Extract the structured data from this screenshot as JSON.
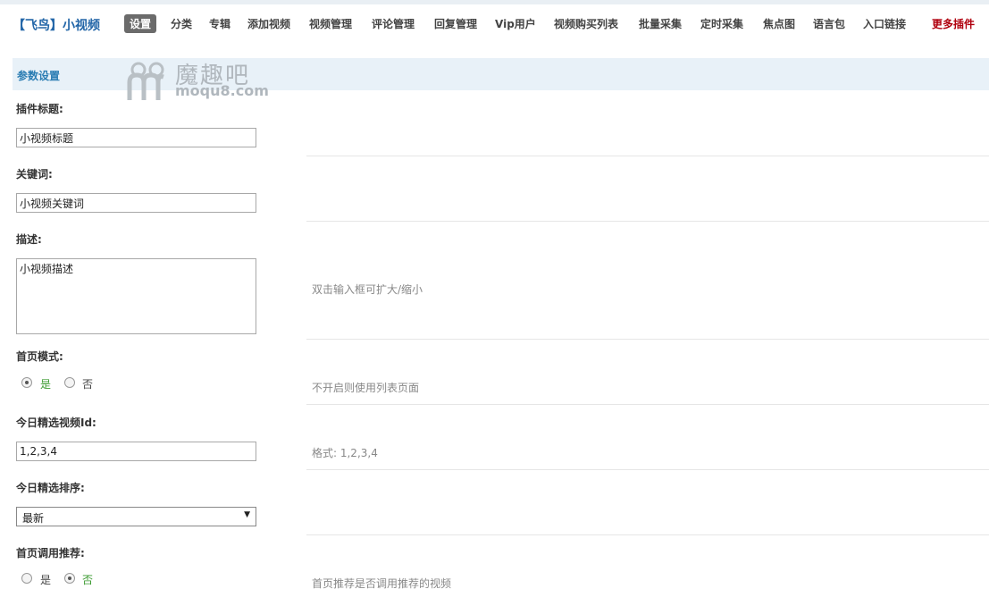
{
  "header": {
    "brand": "【飞鸟】小视频",
    "nav": [
      {
        "label": "设置",
        "active": true
      },
      {
        "label": "分类"
      },
      {
        "label": "专辑"
      },
      {
        "label": "添加视频"
      },
      {
        "label": "视频管理"
      },
      {
        "label": "评论管理"
      },
      {
        "label": "回复管理"
      },
      {
        "label": "Vip用户"
      },
      {
        "label": "视频购买列表"
      },
      {
        "label": "批量采集"
      },
      {
        "label": "定时采集"
      },
      {
        "label": "焦点图"
      },
      {
        "label": "语言包"
      },
      {
        "label": "入口链接"
      }
    ],
    "more": "更多插件"
  },
  "watermark": {
    "line1": "魔趣吧",
    "line2": "moqu8.com"
  },
  "section": {
    "title": "参数设置"
  },
  "form": {
    "plugin_title": {
      "label": "插件标题:",
      "value": "小视频标题"
    },
    "keywords": {
      "label": "关键词:",
      "value": "小视频关键词"
    },
    "description": {
      "label": "描述:",
      "value": "小视频描述",
      "hint": "双击输入框可扩大/缩小"
    },
    "home_mode": {
      "label": "首页模式:",
      "yes": "是",
      "no": "否",
      "selected": "yes",
      "hint": "不开启则使用列表页面"
    },
    "today_ids": {
      "label": "今日精选视频Id:",
      "value": "1,2,3,4",
      "hint": "格式: 1,2,3,4"
    },
    "today_sort": {
      "label": "今日精选排序:",
      "selected": "最新"
    },
    "home_recommend": {
      "label": "首页调用推荐:",
      "yes": "是",
      "no": "否",
      "selected": "no",
      "hint": "首页推荐是否调用推荐的视频"
    }
  },
  "colors": {
    "accent": "#2b7db3",
    "more": "#b0000e",
    "checked_label": "#3a9a2f"
  }
}
